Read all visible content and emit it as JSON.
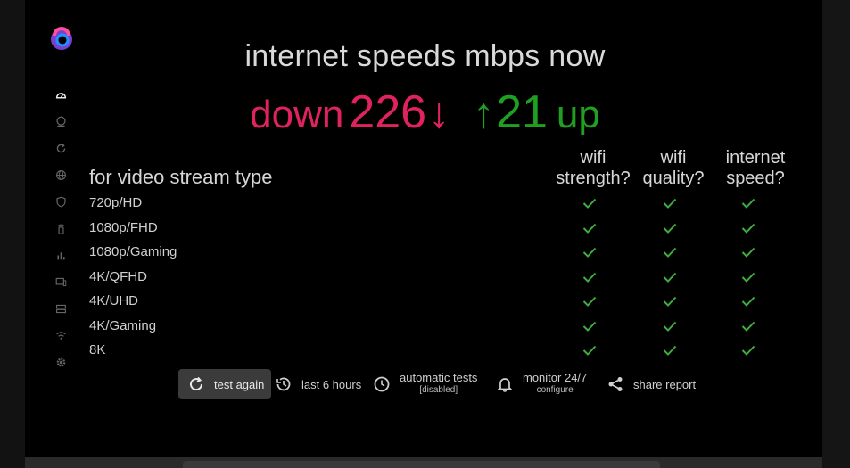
{
  "headline": "internet speeds mbps now",
  "speeds": {
    "down_word": "down",
    "down_value": "226",
    "down_arrow": "↓",
    "up_arrow": "↑",
    "up_value": "21",
    "up_word": "up"
  },
  "colors": {
    "down": "#e0235e",
    "up": "#20a020",
    "check": "#3fae3f"
  },
  "nav_icons": [
    "speedometer-icon",
    "monitor-icon",
    "refresh-icon",
    "globe-icon",
    "shield-icon",
    "router-icon",
    "bar-chart-icon",
    "devices-icon",
    "server-icon",
    "wifi-icon",
    "settings-icon"
  ],
  "table": {
    "title": "for video stream type",
    "columns": [
      {
        "line1": "wifi",
        "line2": "strength?"
      },
      {
        "line1": "wifi",
        "line2": "quality?"
      },
      {
        "line1": "internet",
        "line2": "speed?"
      }
    ],
    "rows": [
      {
        "label": "720p/HD",
        "checks": [
          true,
          true,
          true
        ]
      },
      {
        "label": "1080p/FHD",
        "checks": [
          true,
          true,
          true
        ]
      },
      {
        "label": "1080p/Gaming",
        "checks": [
          true,
          true,
          true
        ]
      },
      {
        "label": "4K/QFHD",
        "checks": [
          true,
          true,
          true
        ]
      },
      {
        "label": "4K/UHD",
        "checks": [
          true,
          true,
          true
        ]
      },
      {
        "label": "4K/Gaming",
        "checks": [
          true,
          true,
          true
        ]
      },
      {
        "label": "8K",
        "checks": [
          true,
          true,
          true
        ]
      }
    ]
  },
  "toolbar": {
    "test_again": "test again",
    "last_hours": "last 6 hours",
    "auto_tests": "automatic tests",
    "auto_tests_sub": "[disabled]",
    "monitor": "monitor 24/7",
    "monitor_sub": "configure",
    "share": "share report"
  }
}
